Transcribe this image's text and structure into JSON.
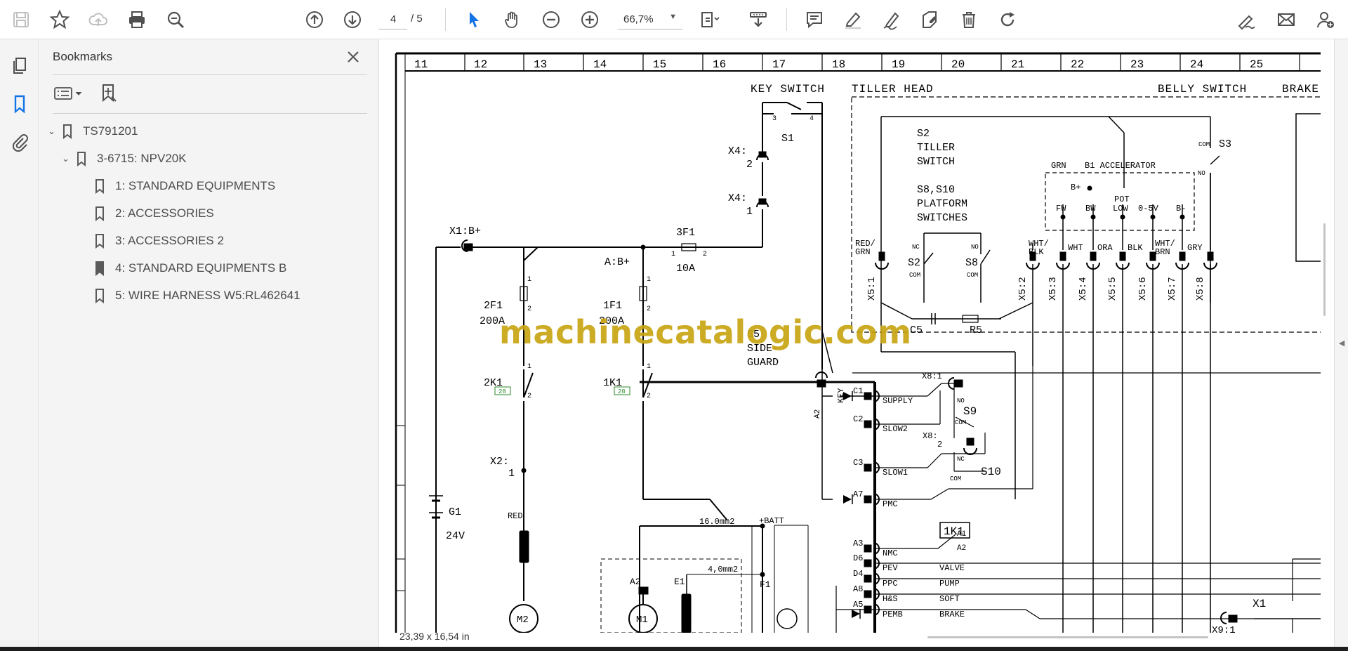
{
  "toolbar": {
    "page_current": "4",
    "page_total": "/  5",
    "zoom": "66,7%",
    "icons": [
      "save-icon",
      "bookmark-star-icon",
      "cloud-upload-icon",
      "print-icon",
      "zoom-search-icon",
      "page-up-icon",
      "page-down-icon",
      "select-cursor-icon",
      "hand-tool-icon",
      "zoom-out-icon",
      "zoom-in-icon",
      "fit-page-icon",
      "scroll-mode-icon",
      "comment-icon",
      "highlight-pen-icon",
      "draw-icon",
      "stamp-icon",
      "delete-icon",
      "rotate-icon",
      "sign-icon",
      "email-icon",
      "share-user-icon"
    ]
  },
  "bookmarks": {
    "title": "Bookmarks",
    "items": [
      {
        "label": "TS791201",
        "level": 0,
        "expanded": true
      },
      {
        "label": "3-6715: NPV20K",
        "level": 1,
        "expanded": true
      },
      {
        "label": "1: STANDARD EQUIPMENTS",
        "level": 2
      },
      {
        "label": "2: ACCESSORIES",
        "level": 2
      },
      {
        "label": "3: ACCESSORIES 2",
        "level": 2
      },
      {
        "label": "4: STANDARD EQUIPMENTS B",
        "level": 2
      },
      {
        "label": "5: WIRE HARNESS W5:RL462641",
        "level": 2
      }
    ]
  },
  "document": {
    "page_size": "23,39 x 16,54 in",
    "watermark": "machinecatalogic.com",
    "column_numbers": [
      "11",
      "12",
      "13",
      "14",
      "15",
      "16",
      "17",
      "18",
      "19",
      "20",
      "21",
      "22",
      "23",
      "24",
      "25"
    ],
    "headers": {
      "key_switch": "KEY SWITCH",
      "tiller_head": "TILLER HEAD",
      "belly_switch": "BELLY SWITCH",
      "brake": "BRAKE"
    },
    "labels": {
      "s1": "S1",
      "x4_2a": "X4:",
      "x4_2b": "2",
      "x4_1a": "X4:",
      "x4_1b": "1",
      "x1": "X1:B+",
      "f3": "3F1",
      "f3_amp": "10A",
      "ab": "A:B+",
      "f2": "2F1",
      "f2_amp": "200A",
      "f1": "1F1",
      "f1_amp": "200A",
      "s5a": "S5",
      "s5b": "SIDE-",
      "s5c": "GUARD",
      "k2": "2K1",
      "k1": "1K1",
      "x2a": "X2:",
      "x2b": "1",
      "g1": "G1",
      "g1_v": "24V",
      "red": "RED",
      "m2": "M2",
      "m1": "M1",
      "a2": "A2",
      "e1": "E1",
      "f1b": "F1",
      "wire16": "16.0mm2",
      "batt": "+BATT",
      "wire4": "4,0mm2",
      "s2a": "S2",
      "s2b": "TILLER",
      "s2c": "SWITCH",
      "s8a": "S8,S10",
      "s8b": "PLATFORM",
      "s8c": "SWITCHES",
      "s2": "S2",
      "s8": "S8",
      "s3": "S3",
      "b1": "B1 ACCELERATOR",
      "grn": "GRN",
      "bplus": "B+",
      "fw": "FW",
      "bw": "BW",
      "pot": "POT",
      "low": "LOW",
      "v05": "0-5V",
      "bminus": "B-",
      "redgrn1": "RED/",
      "redgrn2": "GRN",
      "whtblk1": "WHT/",
      "whtblk2": "BLK",
      "wht": "WHT",
      "ora": "ORA",
      "blk": "BLK",
      "whtbrn1": "WHT/",
      "whtbrn2": "BRN",
      "gry": "GRY",
      "c5": "C5",
      "r5": "R5",
      "x51": "X5:1",
      "x52": "X5:2",
      "x53": "X5:3",
      "x54": "X5:4",
      "x55": "X5:5",
      "x56": "X5:6",
      "x57": "X5:7",
      "x58": "X5:8",
      "key": "KEY",
      "c1": "C1",
      "supply": "SUPPLY",
      "c2": "C2",
      "slow2": "SLOW2",
      "c3": "C3",
      "slow1": "SLOW1",
      "a7": "A7",
      "pmc": "PMC",
      "a3": "A3",
      "nmc": "NMC",
      "d6": "D6",
      "pev": "PEV",
      "valve": "VALVE",
      "d4": "D4",
      "ppc": "PPC",
      "pump": "PUMP",
      "a8": "A8",
      "hs": "H&S",
      "soft": "SOFT",
      "a5": "A5",
      "pemb": "PEMB",
      "brake2": "BRAKE",
      "s9": "S9",
      "s10": "S10",
      "x81": "X8:1",
      "x82": "X8:",
      "x82b": "2",
      "k1box": "1K1",
      "ka1": "A1",
      "ka2": "A2",
      "x1r": "X1",
      "x91": "X9:1",
      "no": "NO",
      "nc": "NC",
      "com": "COM"
    }
  }
}
